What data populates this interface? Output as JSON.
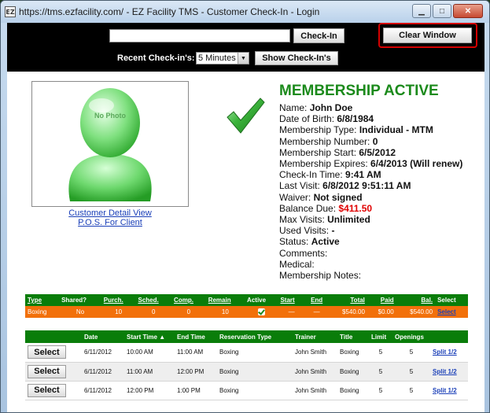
{
  "window": {
    "icon_text": "EZ",
    "title": "https://tms.ezfacility.com/ - EZ Facility TMS - Customer Check-In - Login",
    "minimize": "▁",
    "maximize": "□",
    "close": "✕"
  },
  "topbar": {
    "search_value": "",
    "checkin_label": "Check-In",
    "clear_label": "Clear Window",
    "recent_label": "Recent Check-in's:",
    "recent_selected": "5 Minutes",
    "show_label": "Show Check-In's"
  },
  "photo": {
    "placeholder_text": "No Photo"
  },
  "links": {
    "customer_detail": "Customer Detail View",
    "pos": "P.O.S. For Client"
  },
  "member": {
    "status_title": "MEMBERSHIP ACTIVE",
    "rows": [
      {
        "label": "Name: ",
        "value": "John Doe"
      },
      {
        "label": "Date of Birth: ",
        "value": "6/8/1984"
      },
      {
        "label": "Membership Type: ",
        "value": "Individual - MTM"
      },
      {
        "label": "Membership Number: ",
        "value": "0"
      },
      {
        "label": "Membership Start: ",
        "value": "6/5/2012"
      },
      {
        "label": "Membership Expires: ",
        "value": "6/4/2013 (Will renew)"
      },
      {
        "label": "Check-In Time: ",
        "value": "9:41 AM"
      },
      {
        "label": "Last Visit: ",
        "value": "6/8/2012 9:51:11 AM"
      },
      {
        "label": "Waiver: ",
        "value": "Not signed"
      },
      {
        "label": "Balance Due: ",
        "value": "$411.50"
      },
      {
        "label": "Max Visits: ",
        "value": "Unlimited"
      },
      {
        "label": "Used Visits: ",
        "value": "-"
      },
      {
        "label": "Status: ",
        "value": "Active"
      },
      {
        "label": "Comments:",
        "value": ""
      },
      {
        "label": "Medical:",
        "value": ""
      },
      {
        "label": "Membership Notes:",
        "value": ""
      }
    ]
  },
  "packages": {
    "headers": [
      "Type",
      "Shared?",
      "Purch.",
      "Sched.",
      "Comp.",
      "Remain",
      "Active",
      "Start",
      "End",
      "Total",
      "Paid",
      "Bal.",
      "Select"
    ],
    "row": {
      "type": "Boxing",
      "shared": "No",
      "purch": "10",
      "sched": "0",
      "comp": "0",
      "remain": "10",
      "start": "—",
      "end": "—",
      "total": "$540.00",
      "paid": "$0.00",
      "bal": "$540.00",
      "select": "Select"
    }
  },
  "reservations": {
    "headers": [
      "",
      "Date",
      "Start Time ▲",
      "End Time",
      "Reservation Type",
      "Trainer",
      "Title",
      "Limit",
      "Openings",
      ""
    ],
    "rows": [
      {
        "select": "Select",
        "date": "6/11/2012",
        "start": "10:00 AM",
        "end": "11:00 AM",
        "type": "Boxing",
        "trainer": "John Smith",
        "title": "Boxing",
        "limit": "5",
        "openings": "5",
        "split": "Split 1/2"
      },
      {
        "select": "Select",
        "date": "6/11/2012",
        "start": "11:00 AM",
        "end": "12:00 PM",
        "type": "Boxing",
        "trainer": "John Smith",
        "title": "Boxing",
        "limit": "5",
        "openings": "5",
        "split": "Split 1/2"
      },
      {
        "select": "Select",
        "date": "6/11/2012",
        "start": "12:00 PM",
        "end": "1:00 PM",
        "type": "Boxing",
        "trainer": "John Smith",
        "title": "Boxing",
        "limit": "5",
        "openings": "5",
        "split": "Split 1/2"
      }
    ]
  },
  "colors": {
    "accent_green": "#0a7d0a",
    "status_green": "#1b8a1b",
    "package_orange": "#f2700a",
    "due_red": "#e00000",
    "highlight_red": "#d40000"
  }
}
